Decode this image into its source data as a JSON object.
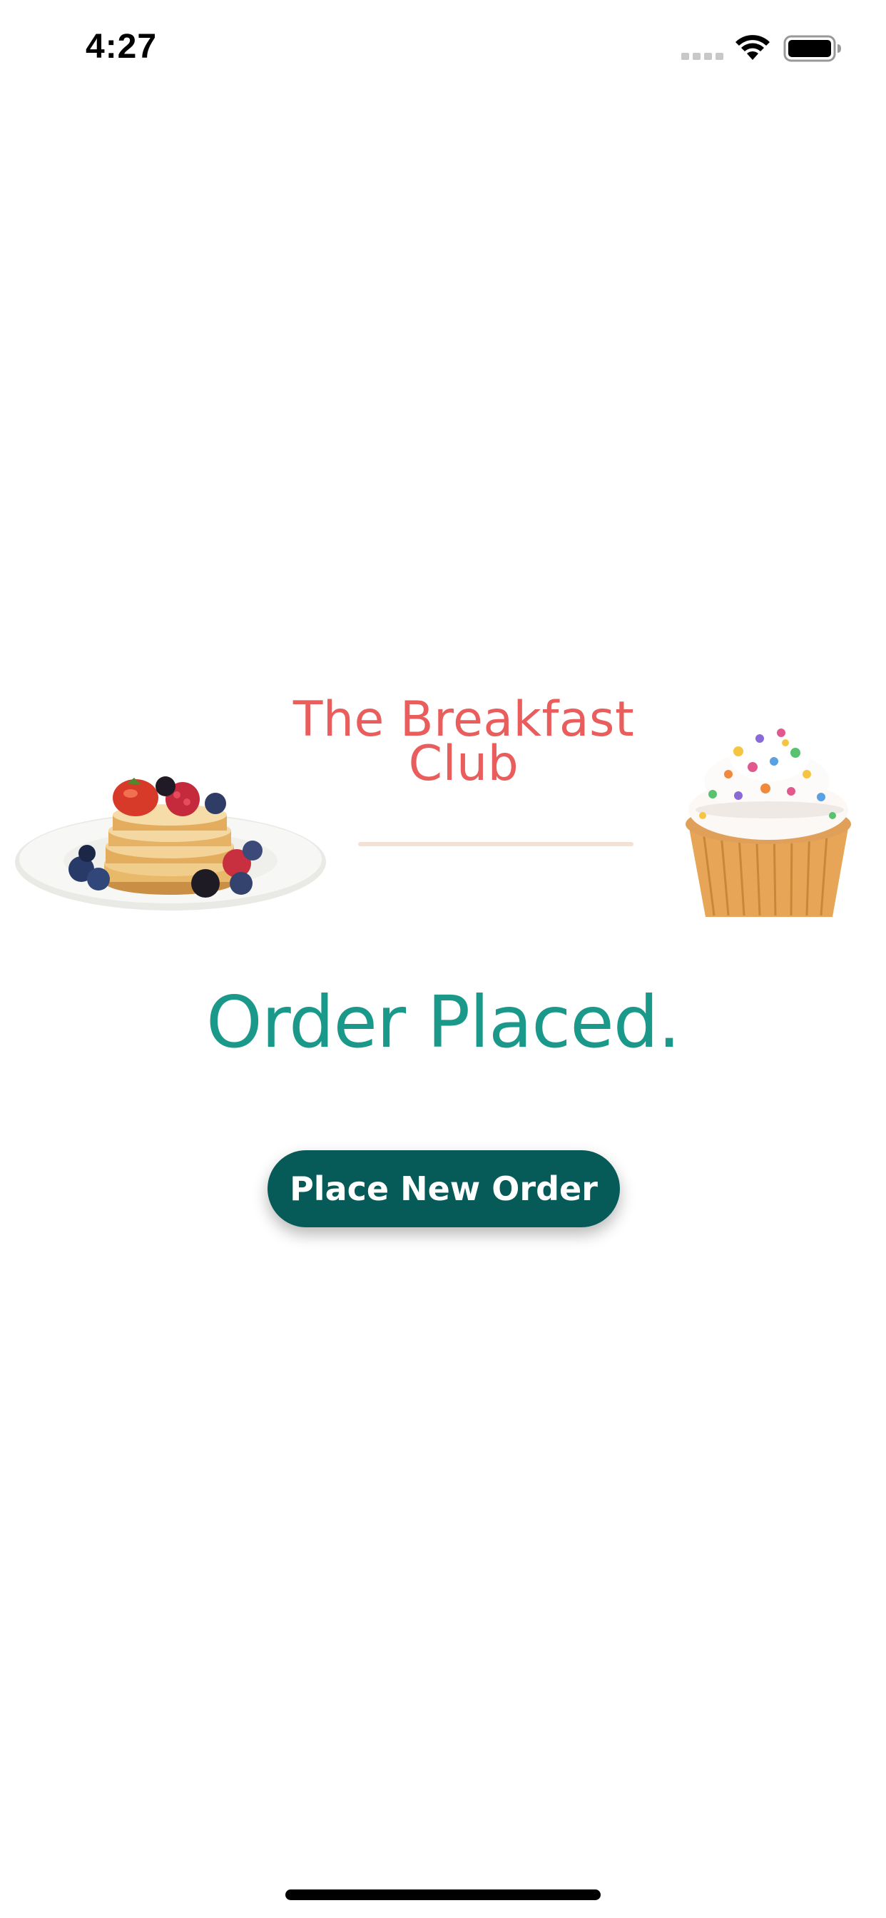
{
  "status_bar": {
    "time": "4:27",
    "icons": [
      "cellular-signal-icon",
      "wifi-icon",
      "battery-icon"
    ]
  },
  "brand": {
    "title": "The Breakfast Club",
    "color": "#e95d5d",
    "divider_color": "#f4e1d6"
  },
  "images": {
    "left": "pancake-stack-with-berries",
    "right": "cupcake-with-sprinkles"
  },
  "order": {
    "status_text": "Order Placed.",
    "color": "#1a998a"
  },
  "actions": {
    "new_order_label": "Place New Order",
    "button_color": "#065a57"
  }
}
